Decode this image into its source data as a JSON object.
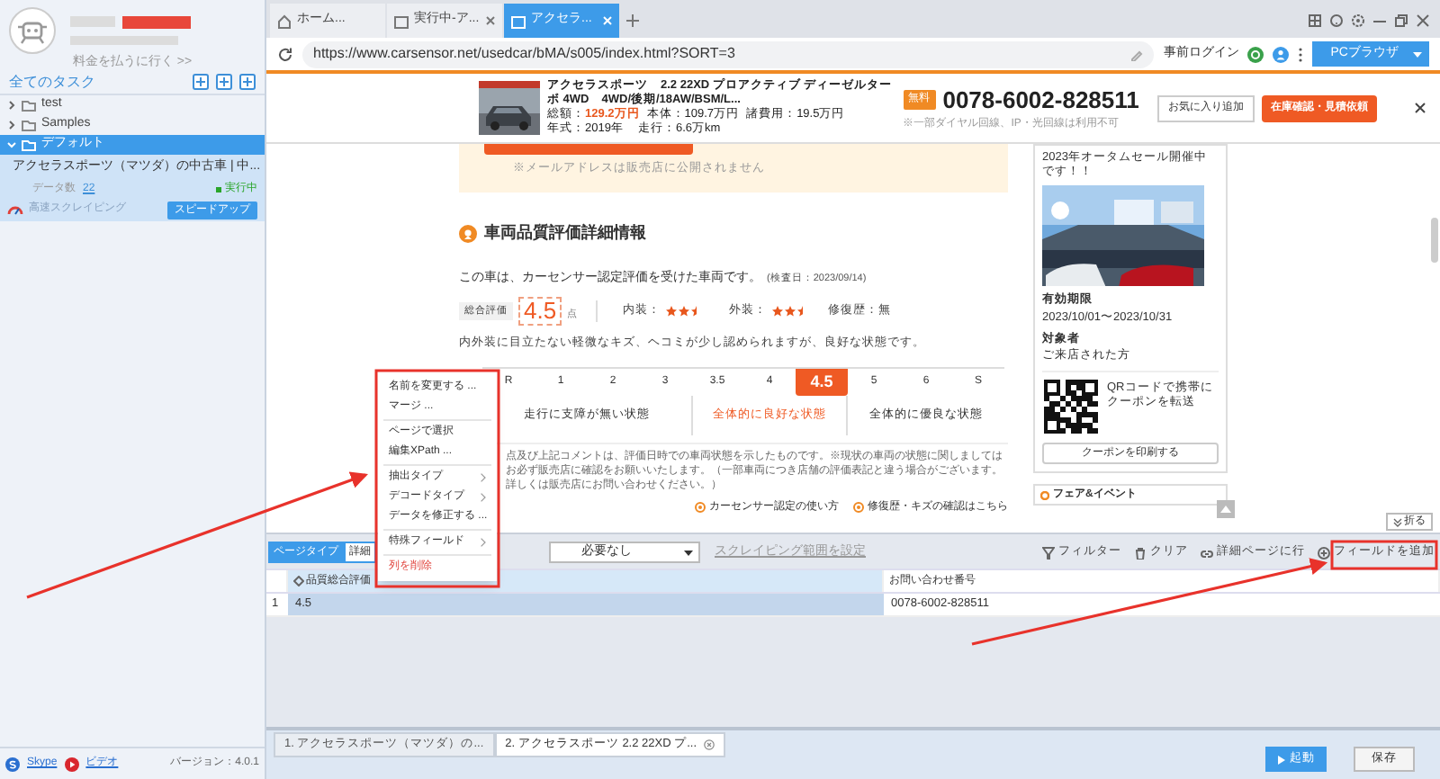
{
  "sidebar": {
    "pay_link": "料金を払うに行く >>",
    "all_tasks": "全てのタスク",
    "tree": [
      {
        "label": "test",
        "expanded": false,
        "selected": false
      },
      {
        "label": "Samples",
        "expanded": false,
        "selected": false
      },
      {
        "label": "デフォルト",
        "expanded": true,
        "selected": true,
        "children": [
          {
            "title": "アクセラスポーツ（マツダ）の中古車 | 中...",
            "count_label": "データ数",
            "count": "22",
            "status": "実行中",
            "mode": "高速スクレイピング",
            "action": "スピードアップ"
          }
        ]
      }
    ],
    "footer": {
      "skype": "Skype",
      "video": "ビデオ",
      "version": "バージョン：4.0.1"
    }
  },
  "browser": {
    "tabs": [
      {
        "label": "ホーム...",
        "kind": "home",
        "selected": false
      },
      {
        "label": "実行中-ア...",
        "kind": "page",
        "selected": false
      },
      {
        "label": "アクセラ...",
        "kind": "page",
        "selected": true
      }
    ],
    "url": "https://www.carsensor.net/usedcar/bMA/s005/index.html?SORT=3",
    "login": "事前ログイン",
    "mode_button": "PCブラウザ"
  },
  "page": {
    "car": {
      "title_lines": [
        "アクセラスポーツ　2.2 22XD プロアクティブ ディーゼルター",
        "ボ 4WD　4WD/後期/18AW/BSM/L..."
      ],
      "total_label": "総額：",
      "total": "129.2万円",
      "body": "本体：109.7万円",
      "fees": "諸費用：19.5万円",
      "year": "年式：2019年",
      "mileage": "走行：6.6万km",
      "free_badge": "無料",
      "phone": "0078-6002-828511",
      "phone_note": "※一部ダイヤル回線、IP・光回線は利用不可",
      "favorite": "お気に入り追加",
      "inquiry": "在庫確認・見積依頼"
    },
    "email_note": "※メールアドレスは販売店に公開されません",
    "heading": "車両品質評価詳細情報",
    "intro": "この車は、カーセンサー認定評価を受けた車両です。",
    "inspection": "(検査日：2023/09/14)",
    "overall_label": "総合評価",
    "overall": "4.5",
    "overall_unit": "点",
    "ratings": [
      {
        "label": "内装：",
        "stars": 2.5
      },
      {
        "label": "外装：",
        "stars": 2.5
      }
    ],
    "repair": "修復歴：無",
    "comment": "内外装に目立たない軽微なキズ、ヘコミが少し認められますが、良好な状態です。",
    "scale": [
      {
        "label": "R",
        "selected": false
      },
      {
        "label": "1",
        "selected": false
      },
      {
        "label": "2",
        "selected": false
      },
      {
        "label": "3",
        "selected": false
      },
      {
        "label": "3.5",
        "selected": false
      },
      {
        "label": "4",
        "selected": false
      },
      {
        "label": "4.5",
        "selected": true
      },
      {
        "label": "5",
        "selected": false
      },
      {
        "label": "6",
        "selected": false
      },
      {
        "label": "S",
        "selected": false
      }
    ],
    "scale_groups": [
      {
        "label": "走行に支障が無い状態",
        "selected": false
      },
      {
        "label": "全体的に良好な状態",
        "selected": true
      },
      {
        "label": "全体的に優良な状態",
        "selected": false
      }
    ],
    "note": "点及び上記コメントは、評価日時での車両状態を示したものです。※現状の車両の状態に関しましてはお必ず販売店に確認をお願いいたします。（一部車両につき店舗の評価表記と違う場合がございます。詳しくは販売店にお問い合わせください。）",
    "links": [
      "カーセンサー認定の使い方",
      "修復歴・キズの確認はこちら"
    ],
    "side": {
      "sale": "2023年オータムセール開催中です！！",
      "validity_label": "有効期限",
      "validity": "2023/10/01〜2023/10/31",
      "target_label": "対象者",
      "target": "ご来店された方",
      "qr_text": "QRコードで携帯にクーポンを転送",
      "print": "クーポンを印刷する",
      "fair": "フェア&イベント",
      "collapse": "折る"
    }
  },
  "context_menu": [
    {
      "label": "名前を変更する ...",
      "kind": "item"
    },
    {
      "label": "マージ ...",
      "kind": "item"
    },
    {
      "kind": "divider"
    },
    {
      "label": "ページで選択",
      "kind": "item"
    },
    {
      "label": "編集XPath ...",
      "kind": "item"
    },
    {
      "kind": "divider"
    },
    {
      "label": "抽出タイプ",
      "kind": "submenu"
    },
    {
      "label": "デコードタイプ",
      "kind": "submenu"
    },
    {
      "label": "データを修正する ...",
      "kind": "item"
    },
    {
      "kind": "divider"
    },
    {
      "label": "特殊フィールド",
      "kind": "submenu"
    },
    {
      "kind": "divider"
    },
    {
      "label": "列を削除",
      "kind": "danger"
    }
  ],
  "panel": {
    "tabs": [
      {
        "label": "ページタイプ",
        "selected": true
      },
      {
        "label": "詳細",
        "selected": false
      }
    ],
    "dropdown": "必要なし",
    "range_link": "スクレイピング範囲を設定",
    "actions": [
      {
        "label": "フィルター",
        "kind": "filter"
      },
      {
        "label": "クリア",
        "kind": "trash"
      },
      {
        "label": "詳細ページに行",
        "kind": "link"
      },
      {
        "label": "フィールドを追加",
        "kind": "add"
      }
    ],
    "table": {
      "columns": [
        {
          "label": "品質総合評価",
          "selected": true
        },
        {
          "label": "お問い合わせ番号",
          "selected": false
        }
      ],
      "rows": [
        {
          "index": "1",
          "cells": [
            "4.5",
            "0078-6002-828511"
          ]
        }
      ]
    }
  },
  "task_tabs": [
    {
      "label": "1. アクセラスポーツ（マツダ）の...",
      "selected": false
    },
    {
      "label": "2. アクセラスポーツ 2.2 22XD プ...",
      "selected": true
    }
  ],
  "start": "起動",
  "save": "保存"
}
